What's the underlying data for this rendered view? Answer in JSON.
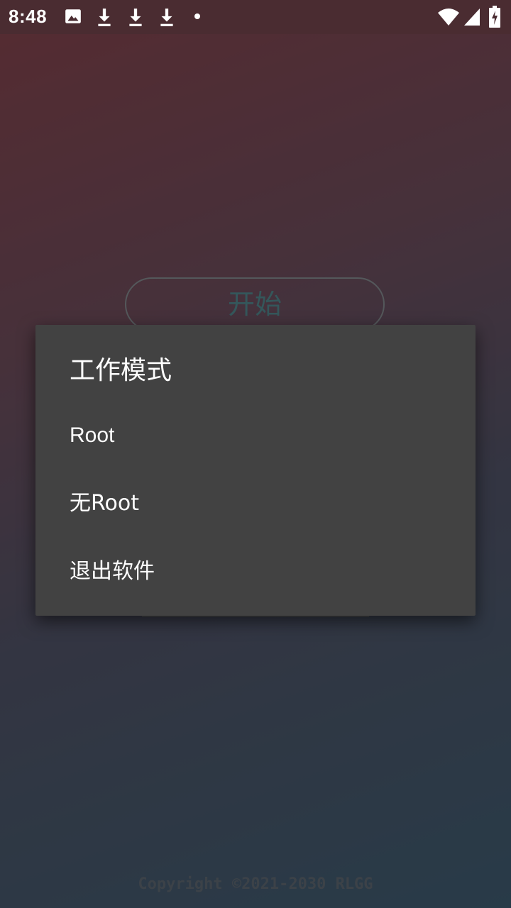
{
  "status_bar": {
    "time": "8:48",
    "icons_left": [
      "image-icon",
      "download-icon",
      "download-icon",
      "download-icon",
      "dot-icon"
    ],
    "icons_right": [
      "wifi-icon",
      "signal-icon",
      "battery-charging-icon"
    ]
  },
  "main": {
    "start_button_label": "开始",
    "copyright": "Copyright ©2021-2030 RLGG"
  },
  "dialog": {
    "title": "工作模式",
    "items": [
      {
        "label": "Root"
      },
      {
        "label": "无Root"
      },
      {
        "label": "退出软件"
      }
    ]
  },
  "colors": {
    "status_bar": "#4a2c31",
    "dialog_bg": "#424242",
    "start_button_text": "#5f9ea6"
  }
}
